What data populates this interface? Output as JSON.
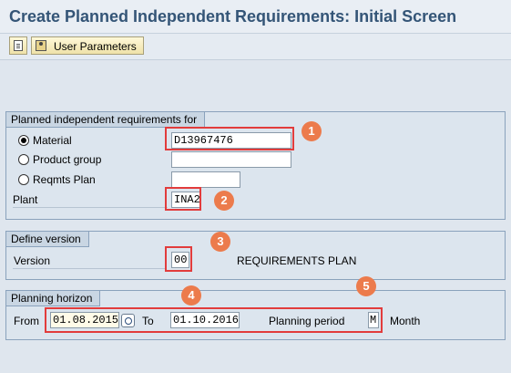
{
  "title": "Create Planned Independent Requirements: Initial Screen",
  "toolbar": {
    "user_params_label": "User Parameters"
  },
  "req_section": {
    "header": "Planned independent requirements for",
    "material_label": "Material",
    "material_value": "D13967476",
    "product_group_label": "Product group",
    "reqmts_plan_label": "Reqmts Plan",
    "plant_label": "Plant",
    "plant_value": "INA2"
  },
  "version_section": {
    "header": "Define version",
    "version_label": "Version",
    "version_value": "00",
    "version_desc": "REQUIREMENTS PLAN"
  },
  "horizon_section": {
    "header": "Planning horizon",
    "from_label": "From",
    "from_value": "01.08.2015",
    "to_label": "To",
    "to_value": "01.10.2016",
    "period_label": "Planning period",
    "period_value": "M",
    "period_desc": "Month"
  },
  "badges": [
    "1",
    "2",
    "3",
    "4",
    "5"
  ],
  "colors": {
    "highlight": "#e23c3c",
    "badge": "#ec7b4c",
    "title": "#345577"
  }
}
